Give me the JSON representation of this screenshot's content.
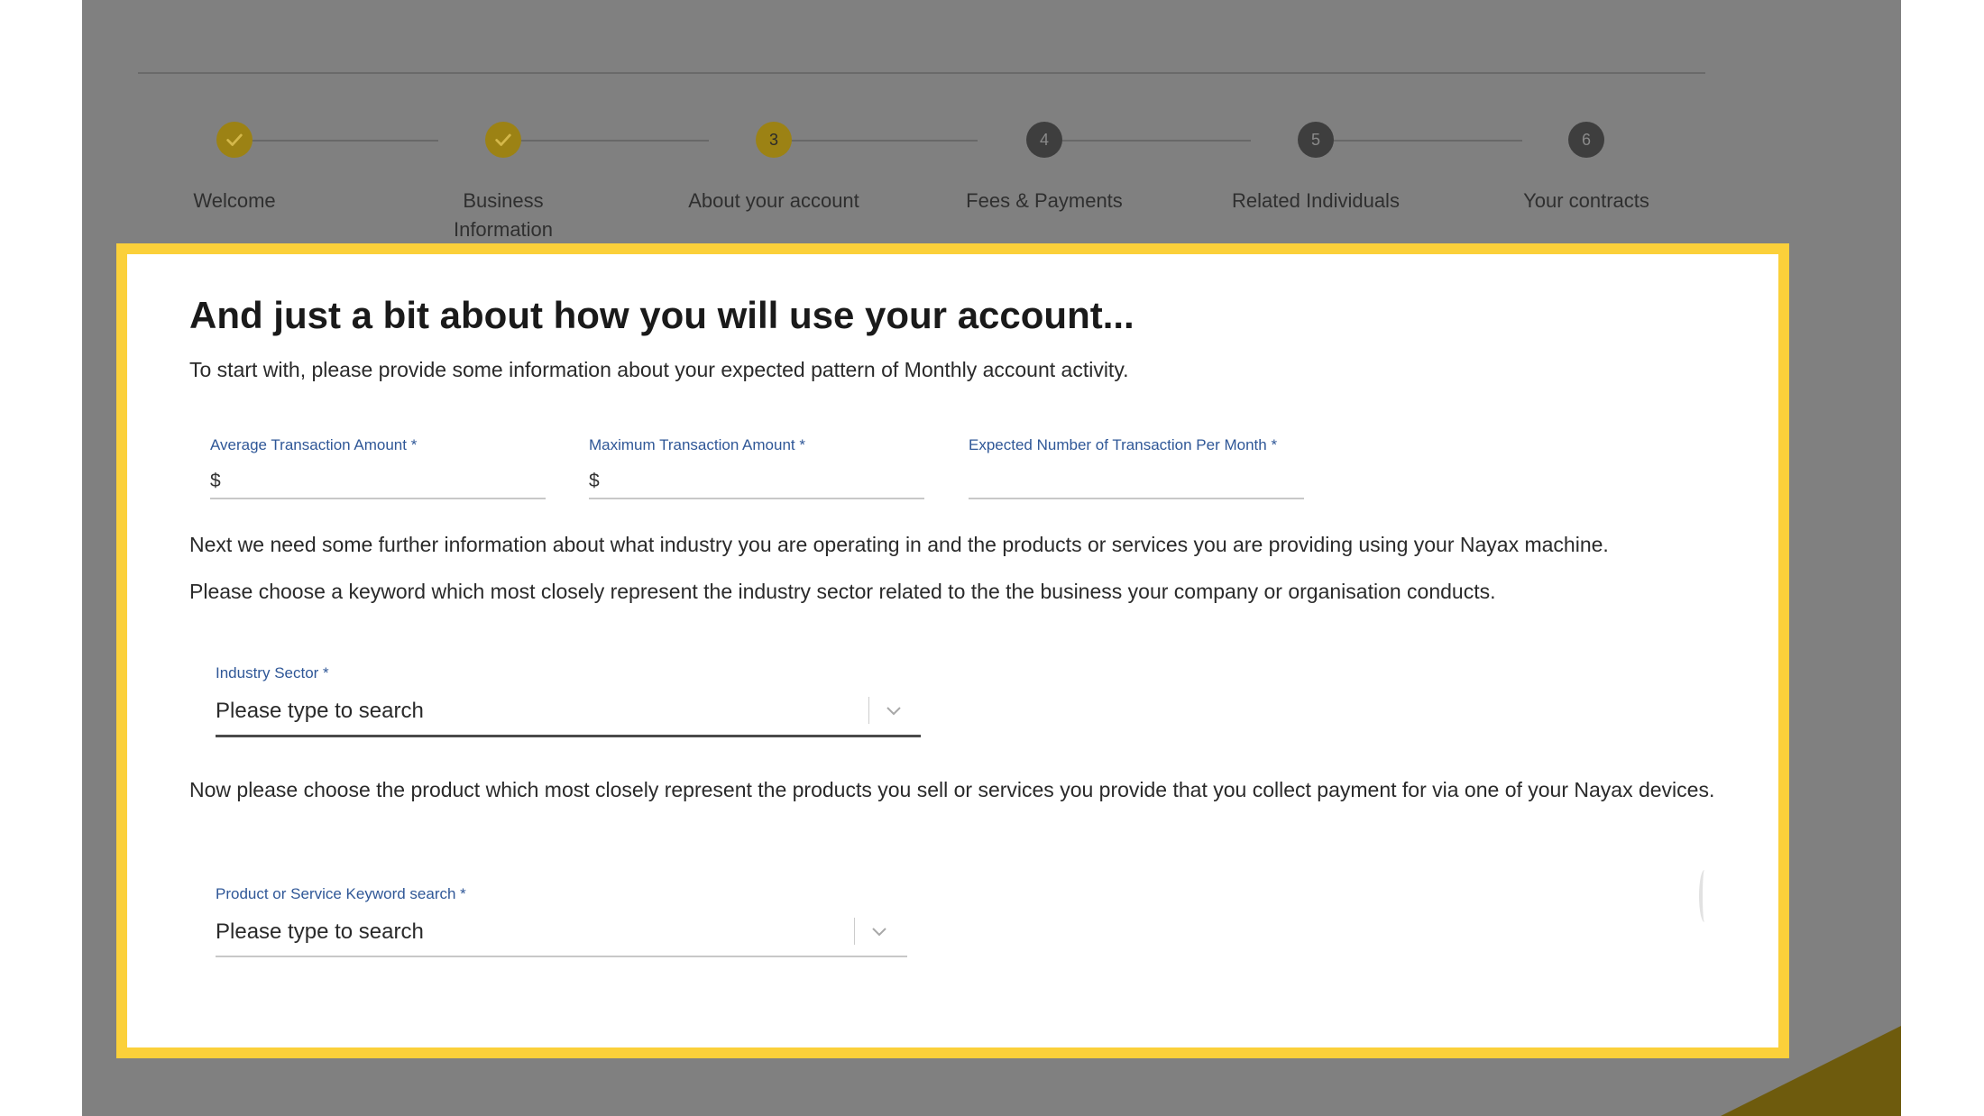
{
  "stepper": {
    "steps": [
      {
        "label": "Welcome",
        "state": "done",
        "icon": "checkmark-icon"
      },
      {
        "label": "Business Information",
        "state": "done",
        "icon": "checkmark-icon"
      },
      {
        "label": "About your account",
        "state": "current",
        "number": "3"
      },
      {
        "label": "Fees & Payments",
        "state": "todo",
        "number": "4"
      },
      {
        "label": "Related Individuals",
        "state": "todo",
        "number": "5"
      },
      {
        "label": "Your contracts",
        "state": "todo",
        "number": "6"
      }
    ]
  },
  "form": {
    "title": "And just a bit about how you will use your account...",
    "intro": "To start with, please provide some information about your expected pattern of Monthly account activity.",
    "avg_amount": {
      "label": "Average Transaction Amount *",
      "prefix": "$",
      "value": ""
    },
    "max_amount": {
      "label": "Maximum Transaction Amount *",
      "prefix": "$",
      "value": ""
    },
    "tx_per_month": {
      "label": "Expected Number of Transaction Per Month  *",
      "value": ""
    },
    "industry_intro": "Next we need some further information about what industry you are operating in and the products or services you are providing using your Nayax machine.",
    "keyword_intro": "Please choose a keyword which most closely represent the industry sector related to the the business your company or organisation conducts.",
    "industry_sector": {
      "label": "Industry Sector *",
      "placeholder": "Please type to search"
    },
    "product_intro": "Now please choose the product which most closely represent the products you sell or services you provide that you collect payment for via one of your Nayax devices.",
    "product_search": {
      "label": "Product or Service Keyword search *",
      "placeholder": "Please type to search"
    }
  },
  "colors": {
    "highlight_border": "#fbd03a",
    "overlay": "#808080",
    "step_done": "#9c8214",
    "step_todo": "#3e3e3e",
    "label_blue": "#2f5797"
  }
}
